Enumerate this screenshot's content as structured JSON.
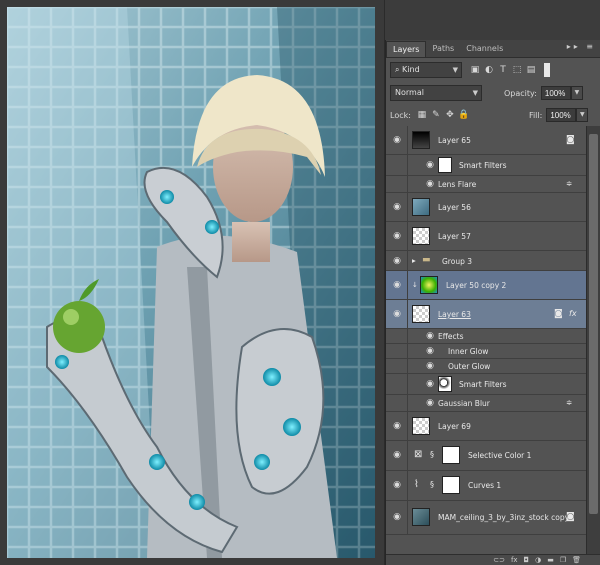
{
  "panel": {
    "tabs": [
      "Layers",
      "Paths",
      "Channels"
    ],
    "filter_kind": "Kind",
    "blend_mode": "Normal",
    "opacity_label": "Opacity:",
    "opacity_value": "100%",
    "lock_label": "Lock:",
    "fill_label": "Fill:",
    "fill_value": "100%"
  },
  "layers": [
    {
      "name": "Layer 65"
    },
    {
      "name": "Smart Filters"
    },
    {
      "name": "Lens Flare"
    },
    {
      "name": "Layer 56"
    },
    {
      "name": "Layer 57"
    },
    {
      "name": "Group 3"
    },
    {
      "name": "Layer 50 copy 2"
    },
    {
      "name": "Layer 63"
    },
    {
      "name": "Effects"
    },
    {
      "name": "Inner Glow"
    },
    {
      "name": "Outer Glow"
    },
    {
      "name": "Smart Filters"
    },
    {
      "name": "Gaussian Blur"
    },
    {
      "name": "Layer 69"
    },
    {
      "name": "Selective Color 1"
    },
    {
      "name": "Curves 1"
    },
    {
      "name": "MAM_ceiling_3_by_3inz_stock copy"
    }
  ],
  "icons": {
    "eye": "eye-icon",
    "fx": "fx"
  }
}
